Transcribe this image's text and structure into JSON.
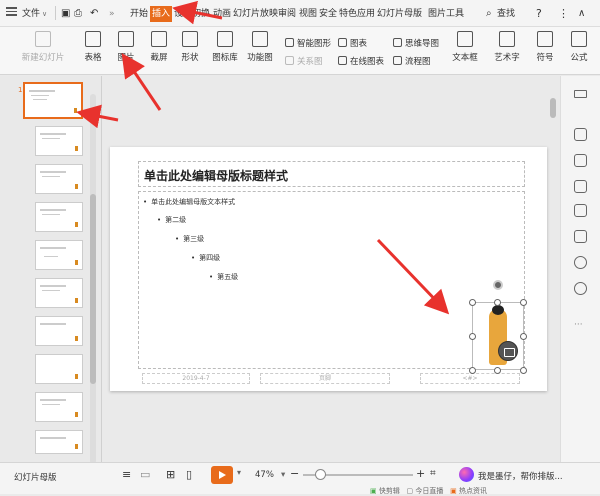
{
  "menubar": {
    "file_label": "文件",
    "tabs": [
      "开始",
      "插入",
      "设计",
      "切换",
      "动画",
      "幻灯片放映",
      "审阅",
      "视图",
      "安全",
      "特色应用",
      "幻灯片母版",
      "图片工具"
    ],
    "search_label": "查找",
    "help_label": "?"
  },
  "ribbon": {
    "new_master": "新建幻灯片",
    "table": "表格",
    "picture": "图片",
    "screenshot": "截屏",
    "shape": "形状",
    "icon_lib": "图标库",
    "func_graph": "功能图",
    "smart_art": "智能图形",
    "chart": "图表",
    "relation": "关系图",
    "online_chart": "在线图表",
    "mindmap": "思维导图",
    "flowchart": "流程图",
    "textbox": "文本框",
    "wordart": "艺术字",
    "symbol": "符号",
    "formula": "公式"
  },
  "slides_panel": {
    "selected_index": "1"
  },
  "slide": {
    "title": "单击此处编辑母版标题样式",
    "bullets": [
      "单击此处编辑母版文本样式",
      "第二级",
      "第三级",
      "第四级",
      "第五级"
    ],
    "footer_date": "2019-4-7",
    "footer_text": "页脚",
    "footer_num": "<#>"
  },
  "status": {
    "view_name": "幻灯片母版",
    "zoom": "47%",
    "minus": "−",
    "plus": "+",
    "helper": "我是墨仔，帮你排版...",
    "bottom_items": [
      "快剪辑",
      "今日直播",
      "热点资讯"
    ]
  },
  "colors": {
    "accent": "#e86b1b",
    "arrow": "#e8322d"
  }
}
